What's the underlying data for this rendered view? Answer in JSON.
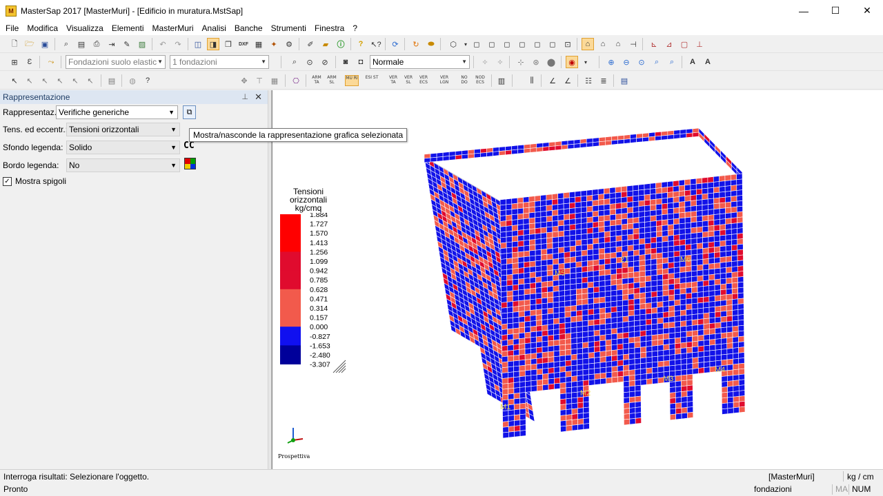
{
  "window": {
    "title": "MasterSap 2017 [MasterMuri] - [Edificio in muratura.MstSap]",
    "minimize": "—",
    "maximize": "☐",
    "close": "✕"
  },
  "menu": [
    "File",
    "Modifica",
    "Visualizza",
    "Elementi",
    "MasterMuri",
    "Analisi",
    "Banche",
    "Strumenti",
    "Finestra",
    "?"
  ],
  "toolbar2": {
    "foundation_combo": "Fondazioni suolo elastic",
    "foundation_count_combo": "1 fondazioni",
    "view_mode_combo": "Normale"
  },
  "toolbar3_labels": [
    "ARM TA",
    "ARM SL",
    "MU RI",
    "ESI ST",
    "VER TA",
    "VER SL",
    "VER ECS",
    "VER LGN",
    "NO DO",
    "NOD ECS"
  ],
  "panel": {
    "title": "Rappresentazione",
    "rappresentazione_label": "Rappresentaz.:",
    "rappresentazione_value": "Verifiche generiche",
    "tensioni_label": "Tens. ed eccentr.:",
    "tensioni_value": "Tensioni orizzontali",
    "sfondo_label": "Sfondo legenda:",
    "sfondo_value": "Solido",
    "bordo_label": "Bordo legenda:",
    "bordo_value": "No",
    "mostra_spigoli": "Mostra spigoli",
    "cc_label": "CC"
  },
  "tooltip": "Mostra/nasconde la rappresentazione grafica selezionata",
  "legend": {
    "title_line1": "Tensioni",
    "title_line2": "orizzontali",
    "unit": "kg/cmq",
    "values": [
      "1.884",
      "1.727",
      "1.570",
      "1.413",
      "1.256",
      "1.099",
      "0.942",
      "0.785",
      "0.628",
      "0.471",
      "0.314",
      "0.157",
      "0.000",
      "-0.827",
      "-1.653",
      "-2.480",
      "-3.307"
    ],
    "colors": [
      "#ff0000",
      "#ff0000",
      "#ff0000",
      "#ff0000",
      "#e00b2e",
      "#e00b2e",
      "#e00b2e",
      "#e00b2e",
      "#f25a4c",
      "#f25a4c",
      "#f25a4c",
      "#f25a4c",
      "#1010f0",
      "#1010f0",
      "#00009a",
      "#00009a"
    ]
  },
  "wall_labels": [
    "M5",
    "M6",
    "M2",
    "M3",
    "M4",
    "M1",
    "21"
  ],
  "axes_label": "Prospettiva",
  "status": {
    "line1": "Interroga risultati: Selezionare l'oggetto.",
    "module": "[MasterMuri]",
    "units": "kg / cm",
    "line2": "Pronto",
    "foundations": "fondazioni",
    "ma": "MA",
    "num": "NUM"
  }
}
